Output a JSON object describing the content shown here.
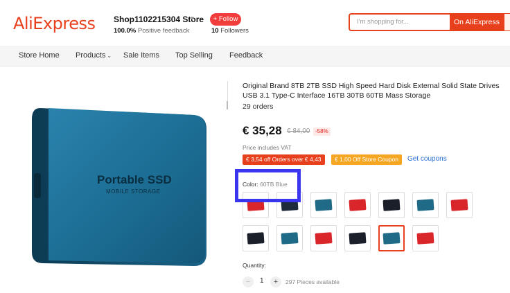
{
  "header": {
    "logo": "AliExpress",
    "store_name": "Shop1102215304 Store",
    "feedback_value": "100.0%",
    "feedback_label": "Positive feedback",
    "follow_label": "+ Follow",
    "followers_count": "10",
    "followers_label": "Followers",
    "search_placeholder": "I'm shopping for...",
    "search_button": "On AliExpress"
  },
  "nav": {
    "items": [
      "Store Home",
      "Products",
      "Sale Items",
      "Top Selling",
      "Feedback"
    ]
  },
  "product": {
    "image_text": "Portable SSD",
    "image_subtext": "MOBILE STORAGE",
    "title": "Original Brand 8TB 2TB SSD High Speed Hard Disk External Solid State Drives USB 3.1 Type-C Interface 16TB 30TB 60TB Mass Storage",
    "orders": "29 orders",
    "price": "€ 35,28",
    "old_price": "€ 84,00",
    "discount": "-58%",
    "vat": "Price includes VAT",
    "coupon1": "€ 3,54 off Orders over € 4,43",
    "coupon2": "€ 1,00 Off Store Coupon",
    "get_coupons": "Get coupons",
    "color_label": "Color:",
    "color_value": "60TB Blue",
    "quantity_label": "Quantity:",
    "quantity": "1",
    "minus": "−",
    "plus": "+",
    "available": "297 Pieces available"
  },
  "swatches": [
    {
      "color": "#d9262a",
      "selected": false
    },
    {
      "color": "#1e2b3c",
      "selected": false
    },
    {
      "color": "#1f6a86",
      "selected": false
    },
    {
      "color": "#d9262a",
      "selected": false
    },
    {
      "color": "#1a1f2a",
      "selected": false
    },
    {
      "color": "#1f6a86",
      "selected": false
    },
    {
      "color": "#d9262a",
      "selected": false
    },
    {
      "color": "#1a1f2a",
      "selected": false
    },
    {
      "color": "#1f6a86",
      "selected": false
    },
    {
      "color": "#d9262a",
      "selected": false
    },
    {
      "color": "#1a1f2a",
      "selected": false
    },
    {
      "color": "#1f6a86",
      "selected": true
    },
    {
      "color": "#d9262a",
      "selected": false
    }
  ],
  "colors": {
    "accent": "#e8401c",
    "highlight": "#3a36f0",
    "link": "#2a6fd6",
    "ssd_body": "#1d6f96"
  }
}
